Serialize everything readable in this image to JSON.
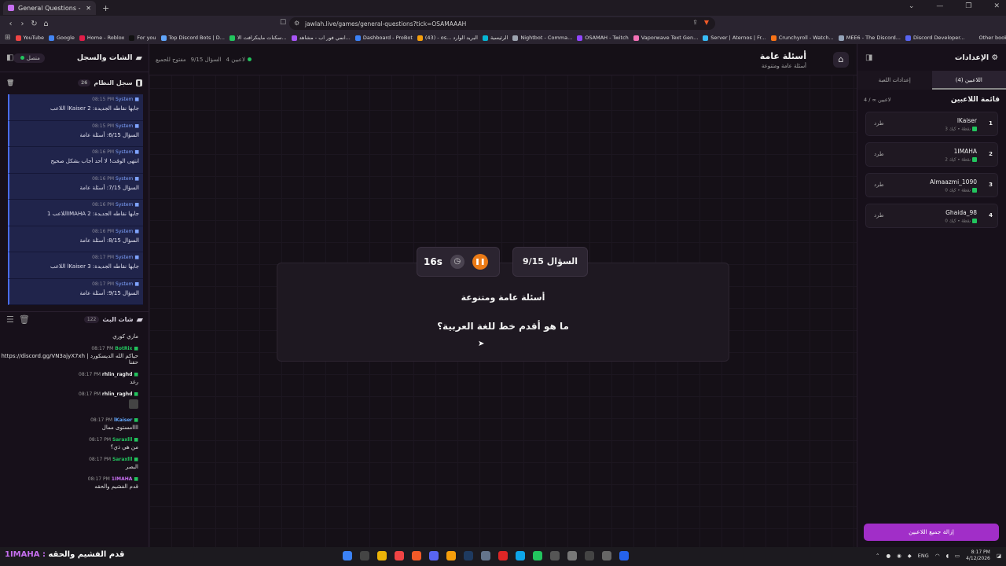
{
  "browser": {
    "tab_title": "General Questions - أسئلة عامة",
    "url": "jawlah.live/games/general-questions?tick=OSAMAAAH",
    "bookmarks": [
      "YouTube",
      "Google",
      "Home - Roblox",
      "For you",
      "Top Discord Bots | D...",
      "سكنات ماينكرافت الا...",
      "انمي فور اب - مشاهد...",
      "Dashboard - ProBot",
      "(43) - os... البريد الوارد",
      "الرئيسية",
      "Nightbot - Comma...",
      "OSAMAH - Twitch",
      "Vaporwave Text Gen...",
      "Server | Aternos | Fr...",
      "Crunchyroll - Watch...",
      "MEE6 - The Discord...",
      "Discord Developer..."
    ],
    "other_bookmarks": "Other bookmarks"
  },
  "left": {
    "title": "الشات والسجل",
    "connected": "متصل",
    "system_log": {
      "title": "سجل النظام",
      "count": "26"
    },
    "logs": [
      {
        "src": "System",
        "time": "08:15 PM",
        "text": "اللاعب lKaiser جابها نقاطه الجديدة: 2"
      },
      {
        "src": "System",
        "time": "08:15 PM",
        "text": "السؤال 6/15: أسئلة عامة"
      },
      {
        "src": "System",
        "time": "08:16 PM",
        "text": "انتهى الوقت! لا أحد أجاب بشكل صحيح"
      },
      {
        "src": "System",
        "time": "08:16 PM",
        "text": "السؤال 7/15: أسئلة عامة"
      },
      {
        "src": "System",
        "time": "08:16 PM",
        "text": "اللاعب 1IMAHA جابها نقاطه الجديدة: 2"
      },
      {
        "src": "System",
        "time": "08:16 PM",
        "text": "السؤال 8/15: أسئلة عامة"
      },
      {
        "src": "System",
        "time": "08:17 PM",
        "text": "اللاعب lKaiser جابها نقاطه الجديدة: 3"
      },
      {
        "src": "System",
        "time": "08:17 PM",
        "text": "السؤال 9/15: أسئلة عامة"
      }
    ],
    "live_chat": {
      "title": "شات البث",
      "count": "122"
    },
    "chat": [
      {
        "user": "",
        "time": "",
        "text": "ماري كوري",
        "color": "#ffffff"
      },
      {
        "user": "BotRix",
        "time": "08:17 PM",
        "text": "https://discord.gg/VN3ajyX7xh | حياكم الله الديسكورد حقنا",
        "color": "#22c55e"
      },
      {
        "user": "rhlin_raghd",
        "time": "08:17 PM",
        "text": "رغد",
        "color": "#e8e8e8"
      },
      {
        "user": "rhlin_raghd",
        "time": "08:17 PM",
        "text": "",
        "color": "#e8e8e8"
      },
      {
        "user": "lKaiser",
        "time": "08:17 PM",
        "text": "مستوى ممالllll",
        "color": "#60a5fa"
      },
      {
        "user": "Saraxlll",
        "time": "08:17 PM",
        "text": "من هي ذي؟",
        "color": "#22c55e"
      },
      {
        "user": "Saraxlll",
        "time": "08:17 PM",
        "text": "البصر",
        "color": "#22c55e"
      },
      {
        "user": "1IMAHA",
        "time": "08:17 PM",
        "text": "قدم الفشيم والحقه",
        "color": "#c66ff0"
      }
    ]
  },
  "center": {
    "title": "أسئلة عامة",
    "subtitle": "أسئلة عامة ومتنوعة",
    "players_status": "4 لاعبين",
    "question_status": "السؤال 9/15",
    "open_status": "مفتوح للجميع",
    "question_counter": "السؤال 9/15",
    "timer": "16s",
    "category": "أسئلة عامة ومتنوعة",
    "question": "ما هو أقدم خط للغة العربية؟"
  },
  "right": {
    "title": "الإعدادات",
    "tab_players": "اللاعبين (4)",
    "tab_game": "إعدادات اللعبة",
    "list_title": "قائمة اللاعبين",
    "list_count": "4 / ∞ لاعبين",
    "kick": "طرد",
    "players": [
      {
        "rank": "1",
        "name": "lKaiser",
        "meta": "3 نقطة • كيك"
      },
      {
        "rank": "2",
        "name": "1IMAHA",
        "meta": "2 نقطة • كيك"
      },
      {
        "rank": "3",
        "name": "Almaazmi_1090",
        "meta": "0 نقطة • كيك"
      },
      {
        "rank": "4",
        "name": "Ghaida_98",
        "meta": "0 نقطة • كيك"
      }
    ],
    "remove_all": "إزالة جميع اللاعبين"
  },
  "taskbar": {
    "overlay_user": "1IMAHA :",
    "overlay_msg": "قدم الفشيم والحقه",
    "lang": "ENG",
    "time": "8:17 PM",
    "date": "4/12/2026"
  }
}
